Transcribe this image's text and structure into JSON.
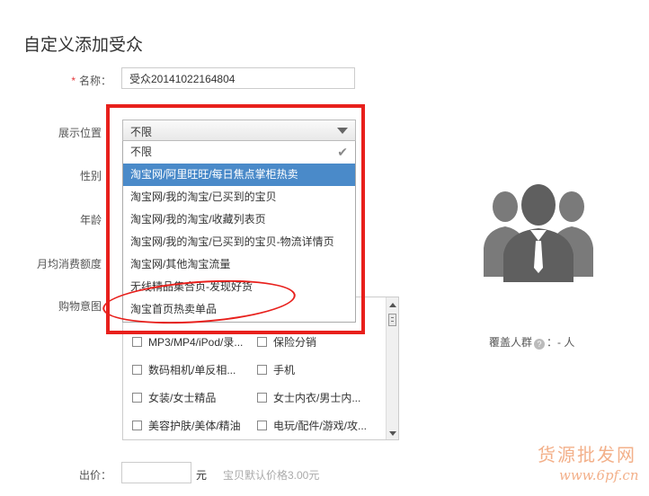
{
  "page": {
    "title": "自定义添加受众"
  },
  "form": {
    "name_label": "名称：",
    "required_mark": "*",
    "name_value": "受众20141022164804",
    "position_label": "展示位置",
    "gender_label": "性别",
    "age_label": "年龄",
    "spending_label": "月均消费额度",
    "intent_label": "购物意图",
    "price_label": "出价：",
    "price_unit": "元",
    "price_hint": "宝贝默认价格3.00元"
  },
  "position_select": {
    "selected": "不限",
    "options": [
      {
        "label": "不限",
        "checked": true
      },
      {
        "label": "淘宝网/阿里旺旺/每日焦点掌柜热卖",
        "highlighted": true
      },
      {
        "label": "淘宝网/我的淘宝/已买到的宝贝"
      },
      {
        "label": "淘宝网/我的淘宝/收藏列表页"
      },
      {
        "label": "淘宝网/我的淘宝/已买到的宝贝-物流详情页"
      },
      {
        "label": "淘宝网/其他淘宝流量"
      },
      {
        "label": "无线精品集合页-发现好货"
      },
      {
        "label": "淘宝首页热卖单品"
      }
    ]
  },
  "categories": [
    [
      "MP3/MP4/iPod/录...",
      "保险分销"
    ],
    [
      "数码相机/单反相...",
      "手机"
    ],
    [
      "女装/女士精品",
      "女士内衣/男士内..."
    ],
    [
      "美容护肤/美体/精油",
      "电玩/配件/游戏/攻..."
    ]
  ],
  "coverage": {
    "label": "覆盖人群",
    "separator": "：",
    "value": "- 人"
  },
  "watermark": {
    "line1": "货源批发网",
    "line2": "www.6pf.cn"
  },
  "colors": {
    "highlight": "#4a8ac9",
    "annotation_red": "#e8201c",
    "icon_gray": "#666666"
  }
}
